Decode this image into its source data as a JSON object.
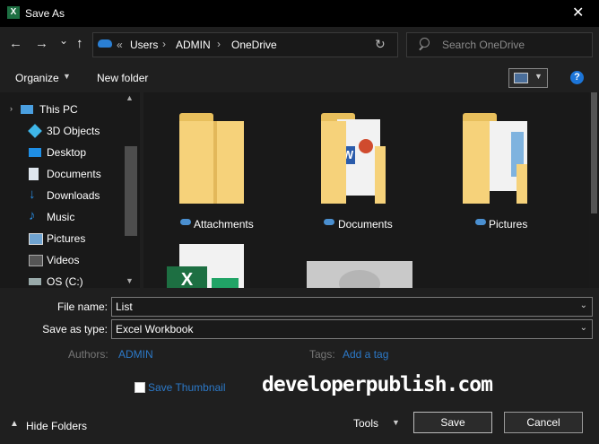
{
  "window": {
    "title": "Save As",
    "close_glyph": "✕",
    "app_icon_letter": "X",
    "app_icon": "excel-icon"
  },
  "nav": {
    "back": "←",
    "forward": "→",
    "recent": "⌄",
    "up": "↑",
    "breadcrumb": {
      "overflow": "«",
      "items": [
        "Users",
        "ADMIN",
        "OneDrive"
      ],
      "separator": "›"
    },
    "refresh": "↻",
    "search_placeholder": "Search OneDrive"
  },
  "toolbar": {
    "organize": "Organize",
    "new_folder": "New folder",
    "help": "?"
  },
  "sidebar": {
    "items": [
      {
        "label": "This PC",
        "icon": "computer-icon"
      },
      {
        "label": "3D Objects",
        "icon": "cube-icon"
      },
      {
        "label": "Desktop",
        "icon": "desktop-icon"
      },
      {
        "label": "Documents",
        "icon": "document-icon"
      },
      {
        "label": "Downloads",
        "icon": "download-icon"
      },
      {
        "label": "Music",
        "icon": "music-icon"
      },
      {
        "label": "Pictures",
        "icon": "picture-icon"
      },
      {
        "label": "Videos",
        "icon": "video-icon"
      },
      {
        "label": "OS (C:)",
        "icon": "drive-icon"
      }
    ]
  },
  "files": [
    {
      "name": "Attachments",
      "type": "folder"
    },
    {
      "name": "Documents",
      "type": "folder-with-docs"
    },
    {
      "name": "Pictures",
      "type": "folder-with-pictures"
    },
    {
      "name": "",
      "type": "excel-file"
    },
    {
      "name": "",
      "type": "image-file"
    }
  ],
  "form": {
    "file_name_label": "File name:",
    "file_name_value": "List",
    "save_type_label": "Save as type:",
    "save_type_value": "Excel Workbook",
    "authors_label": "Authors:",
    "authors_value": "ADMIN",
    "tags_label": "Tags:",
    "tags_value": "Add a tag",
    "thumbnail_label": "Save Thumbnail"
  },
  "footer": {
    "hide_folders": "Hide Folders",
    "tools": "Tools",
    "save": "Save",
    "cancel": "Cancel"
  },
  "watermark": "developerpublish.com",
  "colors": {
    "accent": "#1c75d8",
    "folder": "#f6d27a",
    "excel_green": "#1d6f42",
    "link": "#2c79c8"
  }
}
